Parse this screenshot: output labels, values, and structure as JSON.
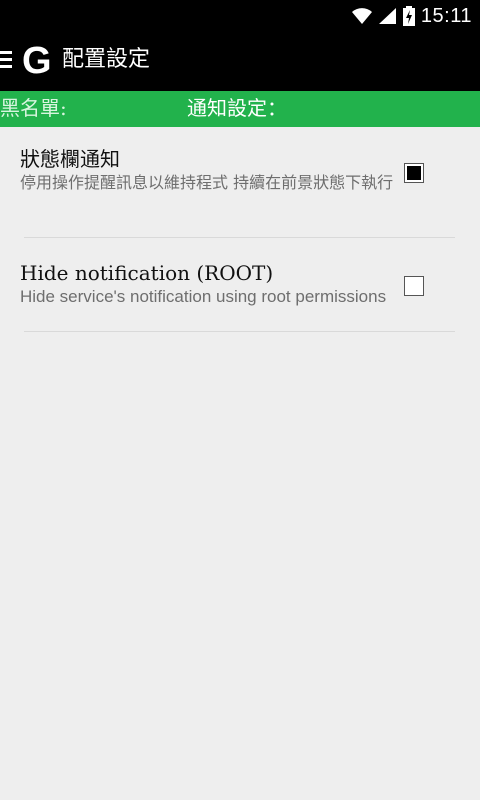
{
  "status": {
    "time": "15:11"
  },
  "appbar": {
    "logo": "G",
    "title": "配置設定"
  },
  "tabs": [
    {
      "label": "黑名單:"
    },
    {
      "label": "通知設定："
    }
  ],
  "prefs": [
    {
      "title": "狀態欄通知",
      "summary": "停用操作提醒訊息以維持程式 持續在前景狀態下執行",
      "checked": true
    },
    {
      "title": "Hide notification (ROOT)",
      "summary": "Hide service's notification using root permissions",
      "checked": false
    }
  ]
}
